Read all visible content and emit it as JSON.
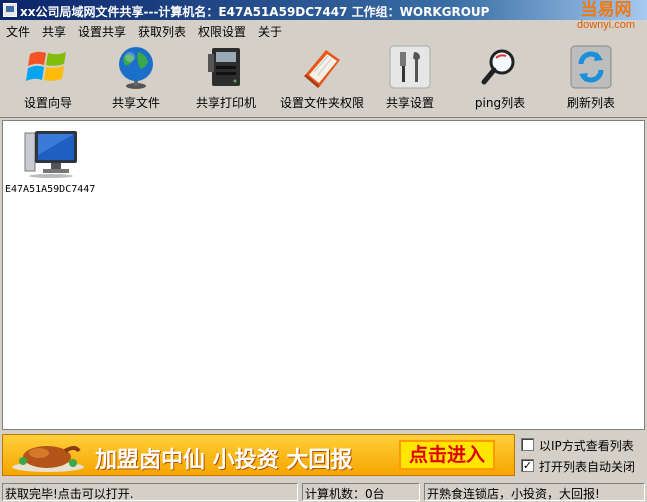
{
  "window": {
    "title": "xx公司局域网文件共享---计算机名：E47A51A59DC7447 工作组：WORKGROUP"
  },
  "watermark": {
    "line1": "当易网",
    "line2": "downyi.com"
  },
  "menu": {
    "items": [
      "文件",
      "共享",
      "设置共享",
      "获取列表",
      "权限设置",
      "关于"
    ]
  },
  "toolbar": {
    "items": [
      {
        "label": "设置向导",
        "icon": "windows-logo-icon"
      },
      {
        "label": "共享文件",
        "icon": "globe-icon"
      },
      {
        "label": "共享打印机",
        "icon": "printer-icon"
      },
      {
        "label": "设置文件夹权限",
        "icon": "folder-book-icon"
      },
      {
        "label": "共享设置",
        "icon": "tools-icon"
      },
      {
        "label": "ping列表",
        "icon": "magnifier-icon"
      },
      {
        "label": "刷新列表",
        "icon": "refresh-icon"
      }
    ]
  },
  "computers": [
    {
      "name": "E47A51A59DC7447"
    }
  ],
  "ad": {
    "slogan": "加盟卤中仙 小投资 大回报",
    "button": "点击进入"
  },
  "options": {
    "ip_view": {
      "label": "以IP方式查看列表",
      "checked": false
    },
    "auto_close": {
      "label": "打开列表自动关闭",
      "checked": true,
      "mark": "✓"
    }
  },
  "status": {
    "message": "获取完毕!点击可以打开.",
    "count": "计算机数：0台",
    "promo": "开熟食连锁店，小投资，大回报!"
  },
  "colors": {
    "titlebar_start": "#0a246a",
    "titlebar_end": "#a6caf0",
    "face": "#d4d0c8",
    "banner": "#f6a500"
  }
}
